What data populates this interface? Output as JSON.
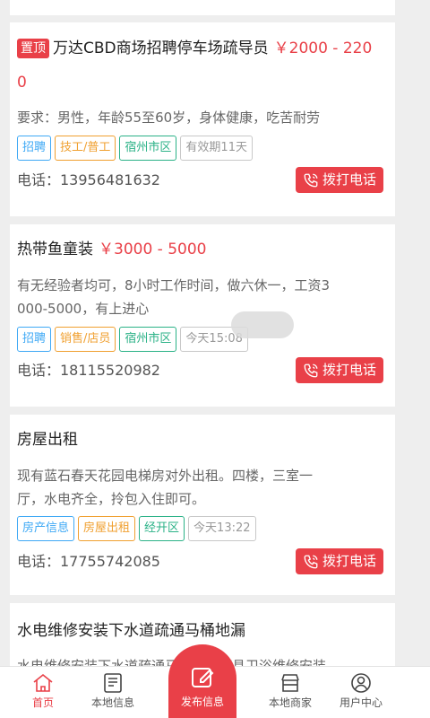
{
  "listings": [
    {
      "pinned_label": "置顶",
      "title": "万达CBD商场招聘停车场疏导员",
      "price_line1": "￥2000 - 220",
      "price_line2": "0",
      "description": "要求：男性，年龄55至60岁，身体健康，吃苦耐劳",
      "tags": [
        "招聘",
        "技工/普工",
        "宿州市区",
        "有效期11天"
      ],
      "phone": "电话：13956481632",
      "call_label": "拨打电话"
    },
    {
      "title": "热带鱼童装",
      "price": "￥3000 - 5000",
      "description_line1": "有无经验者均可，8小时工作时间，做六休一，工资3",
      "description_line2": "000-5000，有上进心",
      "tags": [
        "招聘",
        "销售/店员",
        "宿州市区",
        "今天15:08"
      ],
      "phone": "电话：18115520982",
      "call_label": "拨打电话"
    },
    {
      "title": "房屋出租",
      "description_line1": "现有蓝石春天花园电梯房对外出租。四楼，三室一",
      "description_line2": "厅，水电齐全，拎包入住即可。",
      "tags": [
        "房产信息",
        "房屋出租",
        "经开区",
        "今天13:22"
      ],
      "phone": "电话：17755742085",
      "call_label": "拨打电话"
    },
    {
      "title": "水电维修安装下水道疏通马桶地漏",
      "description_partial": "水电维修安装下水道疏通马桶地漏灯具卫浴维修安装"
    }
  ],
  "tabbar": {
    "home": "首页",
    "local_info": "本地信息",
    "publish": "发布信息",
    "local_merchants": "本地商家",
    "user_center": "用户中心"
  },
  "colors": {
    "accent": "#e94048",
    "tag_blue": "#3fa9f5",
    "tag_orange": "#f0a030",
    "tag_green": "#2bb287",
    "tag_gray": "#999999"
  }
}
